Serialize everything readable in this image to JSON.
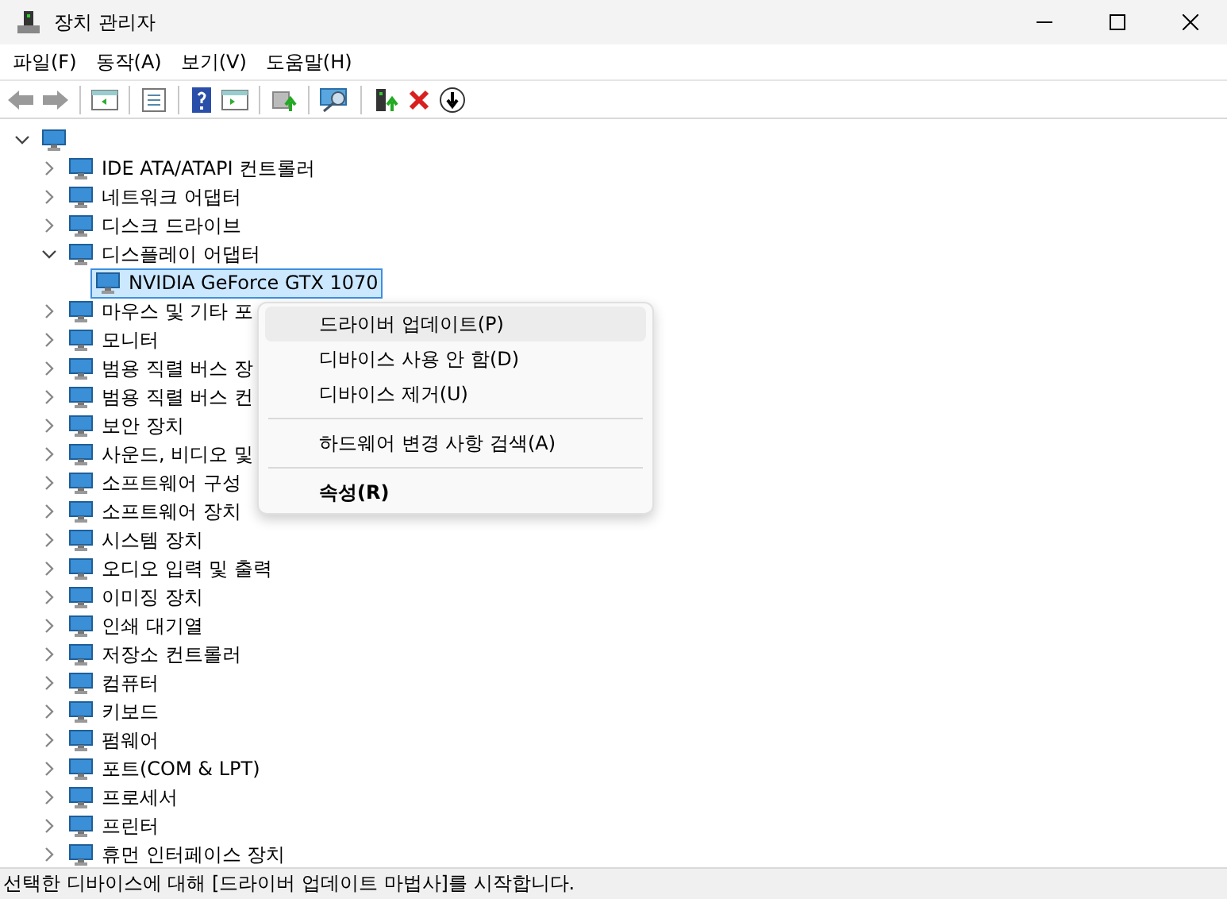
{
  "window": {
    "title": "장치 관리자"
  },
  "menu_bar": [
    "파일(F)",
    "동작(A)",
    "보기(V)",
    "도움말(H)"
  ],
  "tree": {
    "expanded": true,
    "children": [
      {
        "label": "IDE ATA/ATAPI 컨트롤러",
        "expanded": false,
        "selected": false
      },
      {
        "label": "네트워크 어댑터",
        "expanded": false,
        "selected": false
      },
      {
        "label": "디스크 드라이브",
        "expanded": false,
        "selected": false
      },
      {
        "label": "디스플레이 어댑터",
        "expanded": true,
        "selected": false,
        "children": [
          {
            "label": "NVIDIA GeForce GTX 1070",
            "selected": true
          }
        ]
      },
      {
        "label": "마우스 및 기타 포",
        "expanded": false,
        "selected": false
      },
      {
        "label": "모니터",
        "expanded": false,
        "selected": false
      },
      {
        "label": "범용 직렬 버스 장",
        "expanded": false,
        "selected": false
      },
      {
        "label": "범용 직렬 버스 컨",
        "expanded": false,
        "selected": false
      },
      {
        "label": "보안 장치",
        "expanded": false,
        "selected": false
      },
      {
        "label": "사운드, 비디오 및",
        "expanded": false,
        "selected": false
      },
      {
        "label": "소프트웨어 구성",
        "expanded": false,
        "selected": false
      },
      {
        "label": "소프트웨어 장치",
        "expanded": false,
        "selected": false
      },
      {
        "label": "시스템 장치",
        "expanded": false,
        "selected": false
      },
      {
        "label": "오디오 입력 및 출력",
        "expanded": false,
        "selected": false
      },
      {
        "label": "이미징 장치",
        "expanded": false,
        "selected": false
      },
      {
        "label": "인쇄 대기열",
        "expanded": false,
        "selected": false
      },
      {
        "label": "저장소 컨트롤러",
        "expanded": false,
        "selected": false
      },
      {
        "label": "컴퓨터",
        "expanded": false,
        "selected": false
      },
      {
        "label": "키보드",
        "expanded": false,
        "selected": false
      },
      {
        "label": "펌웨어",
        "expanded": false,
        "selected": false
      },
      {
        "label": "포트(COM & LPT)",
        "expanded": false,
        "selected": false
      },
      {
        "label": "프로세서",
        "expanded": false,
        "selected": false
      },
      {
        "label": "프린터",
        "expanded": false,
        "selected": false
      },
      {
        "label": "휴먼 인터페이스 장치",
        "expanded": false,
        "selected": false
      }
    ]
  },
  "context_menu": [
    {
      "kind": "item",
      "label": "드라이버 업데이트(P)",
      "highlighted": true,
      "default": false
    },
    {
      "kind": "item",
      "label": "디바이스 사용 안 함(D)",
      "highlighted": false,
      "default": false
    },
    {
      "kind": "item",
      "label": "디바이스 제거(U)",
      "highlighted": false,
      "default": false
    },
    {
      "kind": "separator"
    },
    {
      "kind": "item",
      "label": "하드웨어 변경 사항 검색(A)",
      "highlighted": false,
      "default": false
    },
    {
      "kind": "separator"
    },
    {
      "kind": "item",
      "label": "속성(R)",
      "highlighted": false,
      "default": true
    }
  ],
  "status_bar": "선택한 디바이스에 대해 [드라이버 업데이트 마법사]를 시작합니다."
}
